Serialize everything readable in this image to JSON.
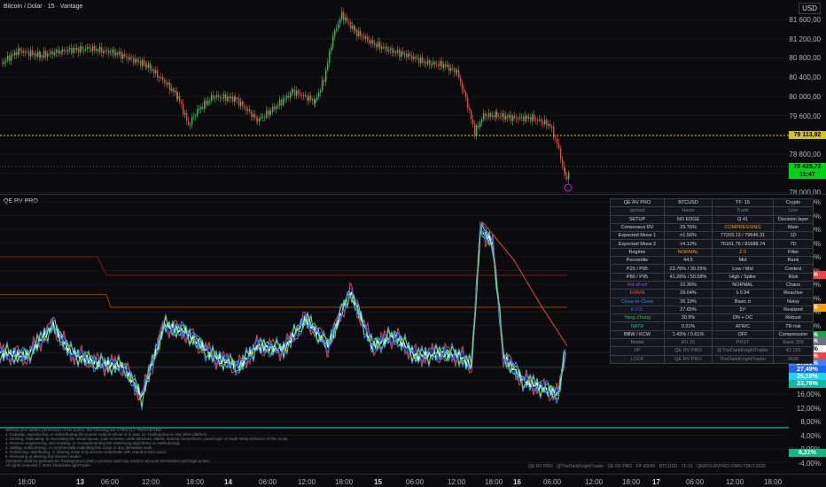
{
  "chart_title": "Bitcoin / Dolar · 15 · Vantage",
  "currency": "USD",
  "indicator_title": "QE RV PRO",
  "price_axis": [
    "81 600,00",
    "81 200,00",
    "80 800,00",
    "80 400,00",
    "80 000,00",
    "79 600,00",
    "79 200,00",
    "78 800,00",
    "78 400,00",
    "78 000,00"
  ],
  "price_badges": {
    "last": "79 113,92",
    "current": "78 425,72",
    "countdown": "11:47"
  },
  "ind_axis": [
    "72,00%",
    "68,00%",
    "64,00%",
    "60,00%",
    "56,00%",
    "52,00%",
    "48,00%",
    "44,00%",
    "40,00%",
    "36,00%",
    "32,00%",
    "28,00%",
    "24,00%",
    "20,00%",
    "16,00%",
    "12,00%",
    "8,00%",
    "4,00%",
    "0,00%",
    "-4,00%"
  ],
  "ind_badges": [
    "50,58%",
    "41,26%",
    "30,90%",
    "30,75%",
    "29,76%",
    "28,64%",
    "27,65%",
    "27,49%",
    "26,19%",
    "23,76%",
    "6,21%"
  ],
  "time_labels": [
    "18:00",
    "13",
    "06:00",
    "12:00",
    "18:00",
    "14",
    "06:00",
    "12:00",
    "18:00",
    "15",
    "06:00",
    "12:00",
    "18:00",
    "16",
    "06:00",
    "12:00",
    "18:00",
    "17",
    "06:00",
    "12:00",
    "18:00"
  ],
  "footer_note": "QE RV PRO · @TheDarkKnightTrader · QE RV PRO · FP 43245 · BTCUSD · TF:15 · QERVS-RVPRO-OWN-TDKT-2026",
  "disclaimer_lines": [
    "Without prior written permission of the author, the following are STRICTLY PROHIBITED:",
    "1. Copying, reproducing, or redistributing the source code in whole or in part, on TradingView or any other platform.",
    "2. Cloning, replicating, or recreating the visual layout, color scheme, table structure, labels, naming conventions, panel logic or trade setup behavior of this script.",
    "3. Reverse engineering, decompiling, or re-implementing the underlying algorithms or methodology.",
    "4. Selling, sublicensing, or commercially exploiting this script or any derivative work.",
    "5. Publishing, distributing, or sharing invite-only access credentials with unauthorized users.",
    "6. Removing or altering this license header.",
    "Violations shall be pursued via TradingView's DMCA process and may result in account termination and legal action.",
    "All rights reserved © 2026 TheDarkKnightTrader"
  ],
  "table": [
    [
      "QE RV PRO",
      "BTCUSD",
      "TF: 15",
      "Crypto"
    ],
    [
      "spread",
      "Haste",
      "Trade",
      "Live"
    ],
    [
      "SETUP",
      "NO EDGE",
      "Q 41",
      "Decision layer"
    ],
    [
      "Consensus RV",
      "29.76%",
      "COMPRESSING",
      "Main"
    ],
    [
      "Expected Move 1",
      "±1.56%",
      "77203.13 / 79646.31",
      "1D"
    ],
    [
      "Expected Move 2",
      "±4.12%",
      "75161.75 / 81688.74",
      "7D"
    ],
    [
      "Regime",
      "NORMAL",
      "Z 0",
      "Filter"
    ],
    [
      "Percentile",
      "44.5",
      "Mid",
      "Rank"
    ],
    [
      "P20 / P95",
      "23.76% / 30.25%",
      "Low / Mid",
      "Context"
    ],
    [
      "P80 / P95",
      "41.26% / 50.58%",
      "High / Spike",
      "Risk"
    ],
    [
      "Vol-of-vol",
      "10.36%",
      "NORMAL",
      "Chaos"
    ],
    [
      "EWMA",
      "28.64%",
      "λ 0.94",
      "Reactive"
    ],
    [
      "Close-to-Close",
      "26.19%",
      "Basic σ",
      "Noisy"
    ],
    [
      "EVOL",
      "27.65%",
      "Σr²",
      "Realized"
    ],
    [
      "Yang-Zhang",
      "30.9%",
      "ON + OC",
      "Robust"
    ],
    [
      "NATR",
      "0.21%",
      "ATR/C",
      "TR risk"
    ],
    [
      "BBW / KCW",
      "1.43% / 0.61%",
      "OFF",
      "Compression"
    ],
    [
      "Model",
      "RV 20",
      "PRST",
      "Rank 200"
    ],
    [
      "FP",
      "QE RV PRO",
      "@TheDarkKnightTrader",
      "43 165"
    ],
    [
      "LOCK",
      "QE RV PRO",
      "TheDarkKnightTrader",
      "2026"
    ]
  ],
  "colors": {
    "up": "#22c55e",
    "down": "#ef4444",
    "yellow": "#d6c21f",
    "green": "#00d21c"
  }
}
